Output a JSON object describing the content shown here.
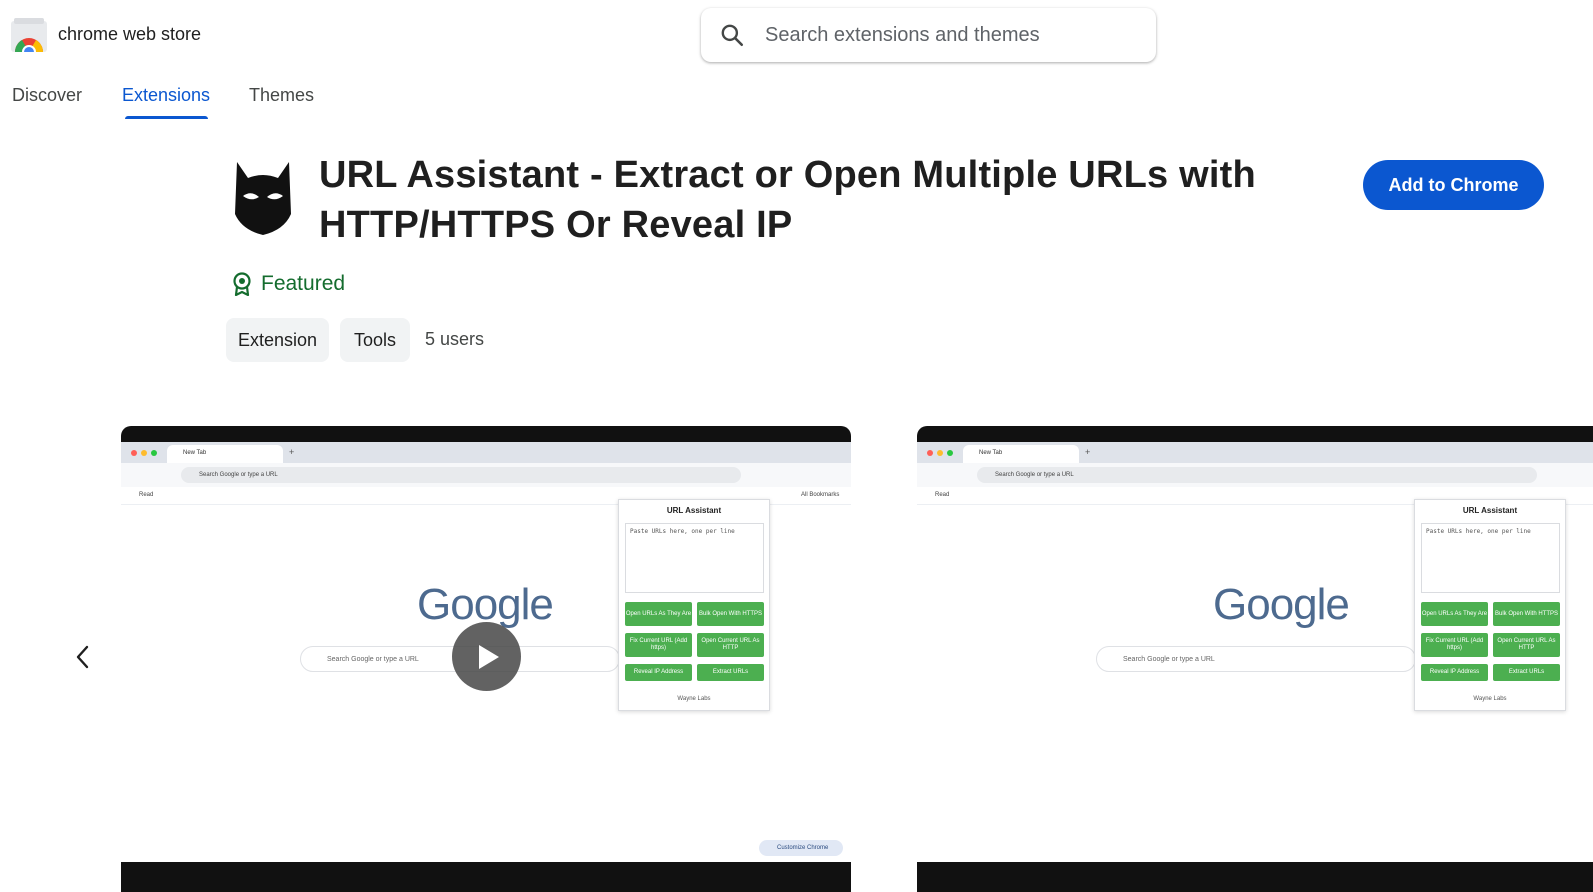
{
  "header": {
    "brand": "chrome web store",
    "search_placeholder": "Search extensions and themes"
  },
  "nav": {
    "tabs": [
      {
        "label": "Discover",
        "active": false
      },
      {
        "label": "Extensions",
        "active": true
      },
      {
        "label": "Themes",
        "active": false
      }
    ]
  },
  "extension": {
    "title": "URL Assistant - Extract or Open Multiple URLs with HTTP/HTTPS Or Reveal IP",
    "featured_label": "Featured",
    "chips": [
      "Extension",
      "Tools"
    ],
    "users": "5 users",
    "add_button": "Add to Chrome"
  },
  "screenshots": [
    {
      "tab_title": "New Tab",
      "omnibox": "Search Google or type a URL",
      "bookmark": "Read",
      "bookmarks_all": "All Bookmarks",
      "google_logo": "Google",
      "google_search": "Search Google or type a URL",
      "panel_title": "URL Assistant",
      "panel_placeholder": "Paste URLs here, one per line",
      "buttons": [
        "Open URLs As They Are",
        "Bulk Open With HTTPS",
        "Fix Current URL (Add https)",
        "Open Current URL As HTTP",
        "Reveal IP Address",
        "Extract URLs"
      ],
      "panel_footer": "Wayne Labs",
      "customize": "Customize Chrome",
      "has_video": true
    },
    {
      "tab_title": "New Tab",
      "omnibox": "Search Google or type a URL",
      "bookmark": "Read",
      "google_logo": "Google",
      "google_search": "Search Google or type a URL",
      "panel_title": "URL Assistant",
      "panel_placeholder": "Paste URLs here, one per line",
      "buttons": [
        "Open URLs As They Are",
        "Bulk Open With HTTPS",
        "Fix Current URL (Add https)",
        "Open Current URL As HTTP",
        "Reveal IP Address",
        "Extract URLs"
      ],
      "panel_footer": "Wayne Labs",
      "has_video": false
    }
  ],
  "colors": {
    "accent": "#0b57d0",
    "featured": "#146c2e",
    "chip_bg": "#f1f3f4",
    "panel_button": "#4caf50"
  },
  "icons": {
    "logo": "chrome-web-store-icon",
    "search": "search-icon",
    "extension": "batman-mask-icon",
    "featured": "award-badge-icon",
    "prev": "chevron-left-icon",
    "play": "play-icon"
  }
}
